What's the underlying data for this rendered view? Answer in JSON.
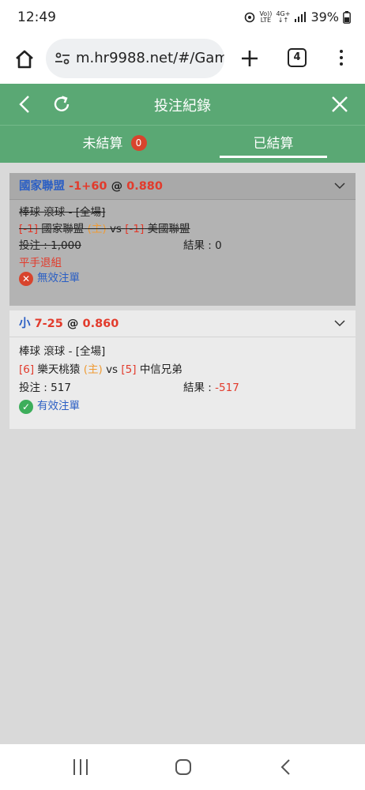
{
  "status_bar": {
    "time": "12:49",
    "net_top": "Vo))",
    "net_bottom": "LTE",
    "signal_top": "4G+",
    "battery": "39%"
  },
  "browser": {
    "url": "m.hr9988.net/#/Gam",
    "tab_count": "4"
  },
  "header": {
    "title": "投注紀錄"
  },
  "tabs": {
    "unsettled_label": "未結算",
    "unsettled_count": "0",
    "settled_label": "已結算"
  },
  "bets": [
    {
      "team": "國家聯盟",
      "line": "-1+60",
      "at": "@",
      "odds": "0.880",
      "sport": "棒球 滾球 - [全場]",
      "home_num": "[-1]",
      "home_team": "國家聯盟",
      "home_tag": "(主)",
      "vs": "vs",
      "away_num": "[-1]",
      "away_team": "美國聯盟",
      "stake_label": "投注 : ",
      "stake": "1,000",
      "result_label": "結果 : ",
      "result": "0",
      "note": "平手退組",
      "status": "無效注單"
    },
    {
      "team": "小",
      "line": "7-25",
      "at": "@",
      "odds": "0.860",
      "sport": "棒球 滾球 - [全場]",
      "home_num": "[6]",
      "home_team": "樂天桃猿",
      "home_tag": "(主)",
      "vs": "vs",
      "away_num": "[5]",
      "away_team": "中信兄弟",
      "stake_label": "投注 : ",
      "stake": "517",
      "result_label": "結果 : ",
      "result": "-517",
      "status": "有效注單"
    }
  ],
  "colors": {
    "header_green": "#5aa874",
    "accent_blue": "#2b5fc4",
    "accent_red": "#e23b2c",
    "home_orange": "#ef9b34",
    "void_red": "#d8442d",
    "valid_green": "#3dae5b"
  },
  "icons": [
    "home-icon",
    "tune-icon",
    "plus-icon",
    "tab-switcher-icon",
    "more-vert-icon",
    "back-icon",
    "refresh-icon",
    "close-icon",
    "chevron-down-icon",
    "x-circle-icon",
    "check-circle-icon"
  ]
}
